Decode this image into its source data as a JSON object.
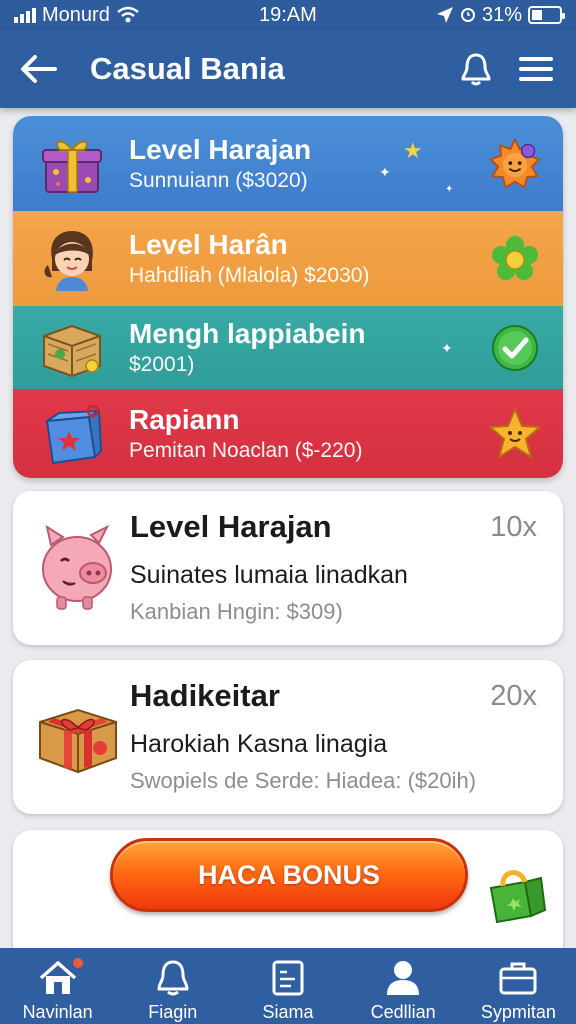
{
  "status_bar": {
    "carrier": "Monurd",
    "time": "19:AM",
    "battery": "31%",
    "icons": [
      "signal-icon",
      "wifi-icon",
      "location-icon",
      "alarm-icon",
      "battery-icon"
    ]
  },
  "header": {
    "title": "Casual Bania",
    "icons": [
      "back-arrow-icon",
      "bell-icon",
      "menu-icon"
    ]
  },
  "levels": [
    {
      "title": "Level Harajan",
      "subtitle": "Sunnuiann ($3020)",
      "color": "#4588d4",
      "art": "gift-box-icon",
      "badge": "sun-face-icon"
    },
    {
      "title": "Level Harân",
      "subtitle": "Hahdliah (Mlalola) $2030)",
      "color": "#f2a044",
      "art": "girl-avatar-icon",
      "badge": "green-flower-icon"
    },
    {
      "title": "Mengh lappiabein",
      "subtitle": "$2001)",
      "color": "#35a49f",
      "art": "treasure-crate-icon",
      "badge": "check-circle-icon"
    },
    {
      "title": "Rapiann",
      "subtitle": "Pemitan Noaclan  ($-220)",
      "color": "#da3445",
      "art": "blue-gift-icon",
      "badge": "star-face-icon"
    }
  ],
  "cards": [
    {
      "title": "Level Harajan",
      "multiplier": "10x",
      "subtitle": "Suinates lumaia linadkan",
      "note": "Kanbian Hngin: $309)",
      "art": "piggy-icon"
    },
    {
      "title": "Hadikeitar",
      "multiplier": "20x",
      "subtitle": "Harokiah Kasna linagia",
      "note": "Swopiels de Serde: Hiadea: ($20ih)",
      "art": "red-ribbon-gift-icon"
    }
  ],
  "bonus": {
    "button_label": "HACA BONUS",
    "art": "green-gift-icon"
  },
  "nav": [
    {
      "label": "Navinlan",
      "icon": "home-icon"
    },
    {
      "label": "Fiagin",
      "icon": "trophy-icon"
    },
    {
      "label": "Siama",
      "icon": "clipboard-icon"
    },
    {
      "label": "Cedllian",
      "icon": "user-icon"
    },
    {
      "label": "Sypmitan",
      "icon": "briefcase-icon"
    }
  ],
  "colors": {
    "header": "#2f5fa1",
    "bonus_button": "#ff6b12",
    "background": "#e9ebef"
  }
}
